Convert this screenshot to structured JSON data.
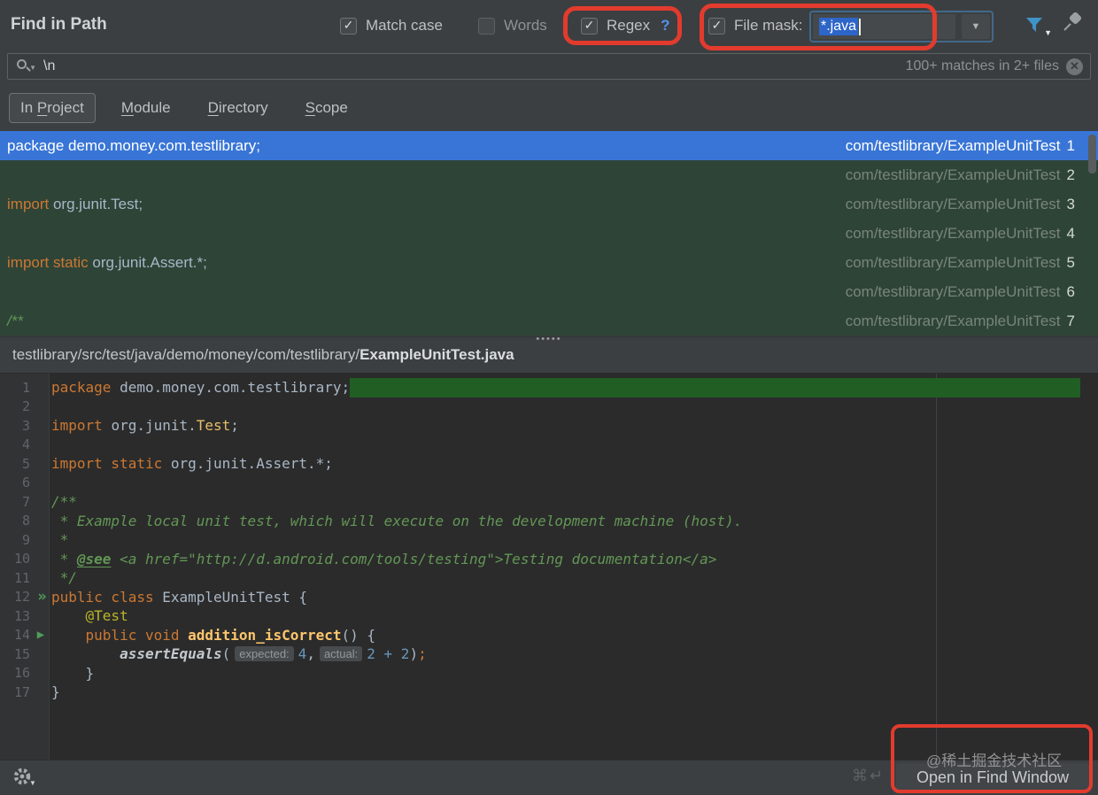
{
  "colors": {
    "annotation_red": "#e23b2e",
    "selection_blue": "#3875d6",
    "result_match_green": "#2e4437",
    "editor_match_green": "#215e24",
    "panel": "#3c3f41",
    "editor_bg": "#2b2b2b",
    "keyword_orange": "#cc7832",
    "comment_green": "#629755",
    "filter_icon_blue": "#3e94c9"
  },
  "header": {
    "title": "Find in Path",
    "match_case": {
      "label": "Match case",
      "checked": true
    },
    "words": {
      "label": "Words",
      "checked": false
    },
    "regex": {
      "label": "Regex",
      "checked": true,
      "help": "?"
    },
    "file_mask": {
      "label": "File mask:",
      "checked": true,
      "value": "*.java"
    },
    "icons": {
      "filter": "filter-funnel-icon",
      "pin": "pin-icon"
    }
  },
  "search": {
    "query": "\\n",
    "matches_hint": "100+ matches in 2+ files",
    "close_glyph": "✕"
  },
  "scope_tabs": [
    {
      "label": "In Project",
      "mnemonic": "P",
      "selected": true
    },
    {
      "label": "Module",
      "mnemonic": "M",
      "selected": false
    },
    {
      "label": "Directory",
      "mnemonic": "D",
      "selected": false
    },
    {
      "label": "Scope",
      "mnemonic": "S",
      "selected": false
    }
  ],
  "results": {
    "file_label": "com/testlibrary/ExampleUnitTest",
    "rows": [
      {
        "line": 1,
        "selected": true,
        "segments": [
          {
            "c": "kw",
            "t": "package "
          },
          {
            "c": "plain",
            "t": "demo.money.com.testlibrary;"
          }
        ]
      },
      {
        "line": 2,
        "selected": false,
        "segments": []
      },
      {
        "line": 3,
        "selected": false,
        "segments": [
          {
            "c": "kw",
            "t": "import "
          },
          {
            "c": "plain",
            "t": "org.junit.Test;"
          }
        ]
      },
      {
        "line": 4,
        "selected": false,
        "segments": []
      },
      {
        "line": 5,
        "selected": false,
        "segments": [
          {
            "c": "kw",
            "t": "import static "
          },
          {
            "c": "plain",
            "t": "org.junit.Assert.*;"
          }
        ]
      },
      {
        "line": 6,
        "selected": false,
        "segments": []
      },
      {
        "line": 7,
        "selected": false,
        "segments": [
          {
            "c": "comment",
            "t": "/**"
          }
        ]
      }
    ]
  },
  "preview": {
    "path": "testlibrary/src/test/java/demo/money/com/testlibrary/",
    "file": "ExampleUnitTest.java"
  },
  "editor": {
    "lines": [
      {
        "n": 1,
        "marker": "",
        "match": true,
        "segments": [
          {
            "c": "kw",
            "t": "package "
          },
          {
            "c": "plain",
            "t": "demo.money.com.testlibrary;"
          }
        ]
      },
      {
        "n": 2,
        "marker": "",
        "match": false,
        "segments": []
      },
      {
        "n": 3,
        "marker": "",
        "match": false,
        "segments": [
          {
            "c": "kw",
            "t": "import "
          },
          {
            "c": "plain",
            "t": "org.junit."
          },
          {
            "c": "cls",
            "t": "Test"
          },
          {
            "c": "plain",
            "t": ";"
          }
        ]
      },
      {
        "n": 4,
        "marker": "",
        "match": false,
        "segments": []
      },
      {
        "n": 5,
        "marker": "",
        "match": false,
        "segments": [
          {
            "c": "kw",
            "t": "import static "
          },
          {
            "c": "plain",
            "t": "org.junit.Assert.*;"
          }
        ]
      },
      {
        "n": 6,
        "marker": "",
        "match": false,
        "segments": []
      },
      {
        "n": 7,
        "marker": "",
        "match": false,
        "segments": [
          {
            "c": "comment",
            "t": "/**"
          }
        ]
      },
      {
        "n": 8,
        "marker": "",
        "match": false,
        "segments": [
          {
            "c": "comment",
            "t": " * Example local unit test, which will execute on the development machine (host)."
          }
        ]
      },
      {
        "n": 9,
        "marker": "",
        "match": false,
        "segments": [
          {
            "c": "comment",
            "t": " *"
          }
        ]
      },
      {
        "n": 10,
        "marker": "",
        "match": false,
        "segments": [
          {
            "c": "comment",
            "t": " * "
          },
          {
            "c": "tag",
            "t": "@see"
          },
          {
            "c": "comment",
            "t": " <a href=\"http://d.android.com/tools/testing\">Testing documentation</a>"
          }
        ]
      },
      {
        "n": 11,
        "marker": "",
        "match": false,
        "segments": [
          {
            "c": "comment",
            "t": " */"
          }
        ]
      },
      {
        "n": 12,
        "marker": "run-class",
        "match": false,
        "segments": [
          {
            "c": "kw",
            "t": "public class "
          },
          {
            "c": "plain",
            "t": "ExampleUnitTest {"
          }
        ]
      },
      {
        "n": 13,
        "marker": "",
        "match": false,
        "segments": [
          {
            "c": "plain",
            "t": "    "
          },
          {
            "c": "ann",
            "t": "@Test"
          }
        ]
      },
      {
        "n": 14,
        "marker": "run-method",
        "match": false,
        "segments": [
          {
            "c": "plain",
            "t": "    "
          },
          {
            "c": "kw",
            "t": "public void "
          },
          {
            "c": "method",
            "t": "addition_isCorrect"
          },
          {
            "c": "plain",
            "t": "() {"
          }
        ]
      },
      {
        "n": 15,
        "marker": "",
        "match": false,
        "segments": [
          {
            "c": "plain",
            "t": "        "
          },
          {
            "c": "smethod",
            "t": "assertEquals"
          },
          {
            "c": "plain",
            "t": "("
          },
          {
            "c": "hint",
            "t": "expected:"
          },
          {
            "c": "num",
            "t": "4"
          },
          {
            "c": "plain",
            "t": ","
          },
          {
            "c": "hint",
            "t": "actual:"
          },
          {
            "c": "num",
            "t": "2 + 2"
          },
          {
            "c": "plain",
            "t": ")"
          },
          {
            "c": "kw",
            "t": ";"
          }
        ]
      },
      {
        "n": 16,
        "marker": "",
        "match": false,
        "segments": [
          {
            "c": "plain",
            "t": "    }"
          }
        ]
      },
      {
        "n": 17,
        "marker": "",
        "match": false,
        "segments": [
          {
            "c": "plain",
            "t": "}"
          }
        ]
      }
    ]
  },
  "footer": {
    "shortcut": "⌘↵",
    "open_button": "Open in Find Window"
  },
  "watermark": "@稀土掘金技术社区"
}
